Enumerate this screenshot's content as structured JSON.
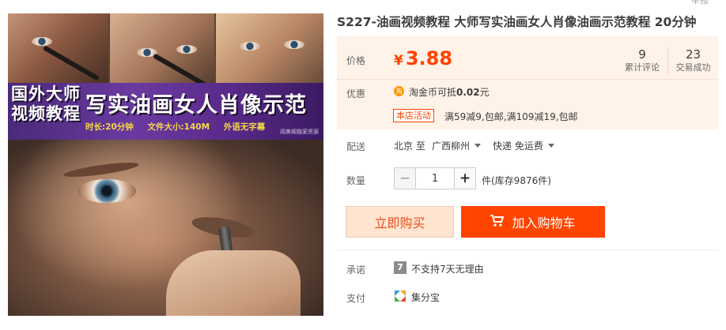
{
  "header": {
    "report_link": "举报"
  },
  "image_text": {
    "left_title_line1": "国外大师",
    "left_title_line2": "视频教程",
    "main_title": "写实油画女人肖像示范",
    "duration": "时长:20分钟",
    "file_size": "文件大小:140M",
    "subtitle_note": "外语无字幕",
    "watermark": "阅美阁独家资源"
  },
  "product": {
    "title": "S227-油画视频教程 大师写实油画女人肖像油画示范教程 20分钟"
  },
  "price": {
    "label": "价格",
    "currency": "¥",
    "value": "3.88",
    "reviews_count": "9",
    "reviews_label": "累计评论",
    "sales_count": "23",
    "sales_label": "交易成功"
  },
  "promo": {
    "label": "优惠",
    "coin_icon": "淘",
    "coin_text_prefix": "淘金币可抵",
    "coin_amount": "0.02",
    "coin_unit": "元",
    "store_badge": "本店活动",
    "store_text": "满59减9,包邮,满109减19,包邮"
  },
  "delivery": {
    "label": "配送",
    "from": "北京 至",
    "to": "广西柳州",
    "method": "快递 免运费"
  },
  "quantity": {
    "label": "数量",
    "minus": "−",
    "value": "1",
    "plus": "+",
    "stock": "件(库存9876件)"
  },
  "actions": {
    "buy_now": "立即购买",
    "add_to_cart": "加入购物车"
  },
  "promise": {
    "label": "承诺",
    "icon_text": "7",
    "text": "不支持7天无理由"
  },
  "payment": {
    "label": "支付",
    "text": "集分宝"
  },
  "colors": {
    "accent": "#ff4400",
    "price_bg": "#fff2e8",
    "buy_bg": "#ffe4d0"
  }
}
